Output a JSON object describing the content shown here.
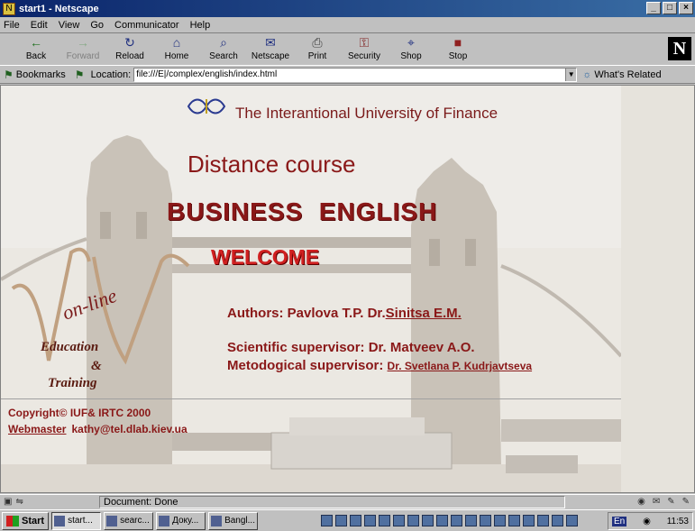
{
  "window": {
    "title": "start1 - Netscape",
    "min": "_",
    "max": "□",
    "close": "×"
  },
  "menu": [
    "File",
    "Edit",
    "View",
    "Go",
    "Communicator",
    "Help"
  ],
  "toolbar": [
    {
      "label": "Back",
      "icon": "←"
    },
    {
      "label": "Forward",
      "icon": "→"
    },
    {
      "label": "Reload",
      "icon": "↻"
    },
    {
      "label": "Home",
      "icon": "⌂"
    },
    {
      "label": "Search",
      "icon": "⌕"
    },
    {
      "label": "Netscape",
      "icon": "✉"
    },
    {
      "label": "Print",
      "icon": "⎙"
    },
    {
      "label": "Security",
      "icon": "⚿"
    },
    {
      "label": "Shop",
      "icon": "⌖"
    },
    {
      "label": "Stop",
      "icon": "■"
    }
  ],
  "netscape_logo": "N",
  "location": {
    "bookmarks": "Bookmarks",
    "label": "Location:",
    "url": "file:///E|/complex/english/index.html",
    "related": "What's Related"
  },
  "page": {
    "university": "The Interantional University of Finance",
    "distance": "Distance course",
    "business": "BUSINESS  ENGLISH",
    "welcome": "WELCOME",
    "authors_prefix": "Authors: Pavlova T.P. Dr.",
    "authors_link": "Sinitsa E.M.",
    "scientific": "Scientific supervisor: Dr. Matveev A.O.",
    "meto_prefix": "Metodogical supervisor: ",
    "meto_link": "Dr. Svetlana P. Kudrjavtseva",
    "logo_online": "on-line",
    "logo_education": "Education",
    "logo_amp": "&",
    "logo_training": "Training",
    "copyright": "Copyright©  IUF& IRTC 2000",
    "webmaster_label": "Webmaster",
    "webmaster_email": "kathy@tel.dlab.kiev.ua"
  },
  "status": {
    "text": "Document: Done"
  },
  "taskbar": {
    "start": "Start",
    "tasks": [
      {
        "label": "start...",
        "active": true
      },
      {
        "label": "searc...",
        "active": false
      },
      {
        "label": "Доку...",
        "active": false
      },
      {
        "label": "Bangl...",
        "active": false
      }
    ],
    "lang": "En",
    "time": "11:53"
  }
}
